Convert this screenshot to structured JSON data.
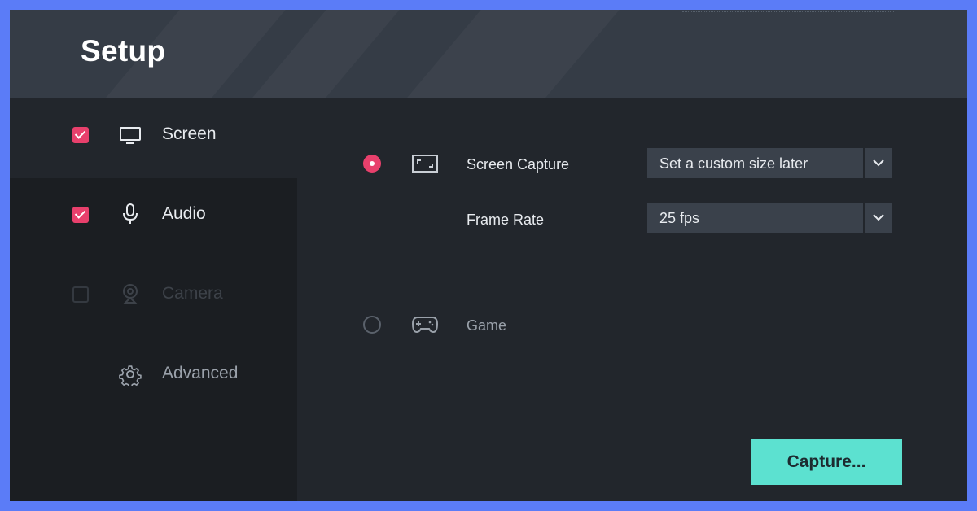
{
  "header": {
    "title": "Setup"
  },
  "sidebar": {
    "items": [
      {
        "label": "Screen",
        "checked": true,
        "icon": "monitor-icon"
      },
      {
        "label": "Audio",
        "checked": true,
        "icon": "microphone-icon"
      },
      {
        "label": "Camera",
        "checked": false,
        "disabled": true,
        "icon": "webcam-icon"
      },
      {
        "label": "Advanced",
        "icon": "gear-icon"
      }
    ]
  },
  "main": {
    "screen_capture": {
      "label": "Screen Capture",
      "selected": true,
      "icon": "fullscreen-icon",
      "size_value": "Set a custom size later"
    },
    "frame_rate": {
      "label": "Frame Rate",
      "value": "25 fps"
    },
    "game": {
      "label": "Game",
      "selected": false,
      "icon": "gamepad-icon"
    },
    "capture_button": "Capture..."
  },
  "colors": {
    "accent": "#e8406c",
    "capture_button": "#5ce1d0",
    "header_bg": "#353c46",
    "panel_bg": "#22262c",
    "sidebar_bg": "#1b1e22"
  }
}
